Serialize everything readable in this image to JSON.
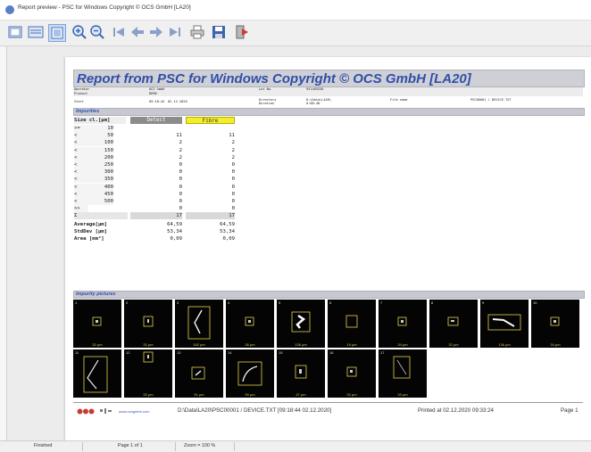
{
  "window": {
    "title": "Report preview - PSC for Windows Copyright © OCS GmbH [LA20]"
  },
  "toolbar": {
    "buttons": [
      {
        "name": "page-view-icon"
      },
      {
        "name": "page-width-icon"
      },
      {
        "name": "full-page-icon"
      },
      {
        "name": "zoom-in-icon"
      },
      {
        "name": "zoom-out-icon"
      },
      {
        "name": "first-page-icon"
      },
      {
        "name": "previous-page-icon"
      },
      {
        "name": "next-page-icon"
      },
      {
        "name": "last-page-icon"
      },
      {
        "name": "print-icon"
      },
      {
        "name": "save-icon"
      },
      {
        "name": "exit-icon"
      }
    ]
  },
  "report": {
    "title": "Report from PSC for Windows Copyright © OCS GmbH [LA20]",
    "meta": {
      "operator_label": "Operator",
      "operator_value": "OCS GmbH",
      "product_label": "Product",
      "product_value": "DEMO",
      "lot_label": "Lot No.",
      "lot_value": "931485536",
      "start_label": "Start",
      "start_date": "09:18:44",
      "start_time": "02.12.2020",
      "directory_label": "Directory",
      "directory_value": "D:\\Data\\LA20\\",
      "duration_label": "Duration",
      "duration_value": "0:00:48",
      "filename_label": "File name",
      "filename_value": "PSC00001 / DEVICE.TXT"
    },
    "impurities": {
      "section_title": "Impurities",
      "size_header": "Size cl.[µm]",
      "col_detect": "Detect",
      "col_fibre": "Fibre",
      "rows": [
        {
          "op": ">=",
          "size": "10",
          "detect": "",
          "fibre": ""
        },
        {
          "op": "<",
          "size": "50",
          "detect": "11",
          "fibre": "11"
        },
        {
          "op": "<",
          "size": "100",
          "detect": "2",
          "fibre": "2"
        },
        {
          "op": "<",
          "size": "150",
          "detect": "2",
          "fibre": "2"
        },
        {
          "op": "<",
          "size": "200",
          "detect": "2",
          "fibre": "2"
        },
        {
          "op": "<",
          "size": "250",
          "detect": "0",
          "fibre": "0"
        },
        {
          "op": "<",
          "size": "300",
          "detect": "0",
          "fibre": "0"
        },
        {
          "op": "<",
          "size": "350",
          "detect": "0",
          "fibre": "0"
        },
        {
          "op": "<",
          "size": "400",
          "detect": "0",
          "fibre": "0"
        },
        {
          "op": "<",
          "size": "450",
          "detect": "0",
          "fibre": "0"
        },
        {
          "op": "<",
          "size": "500",
          "detect": "0",
          "fibre": "0"
        },
        {
          "op": ">>",
          "size": "",
          "detect": "0",
          "fibre": "0"
        }
      ],
      "sum": {
        "label": "Σ",
        "detect": "17",
        "fibre": "17"
      },
      "stats": [
        {
          "label": "Average[µm]",
          "detect": "64,59",
          "fibre": "64,59"
        },
        {
          "label": "StdDev [µm]",
          "detect": "53,34",
          "fibre": "53,34"
        },
        {
          "label": "Area   [mm²]",
          "detect": "0,09",
          "fibre": "0,09"
        }
      ]
    },
    "pictures": {
      "section_title": "Impurity pictures",
      "items": [
        {
          "n": "1",
          "label": "32 µm"
        },
        {
          "n": "2",
          "label": "32 µm"
        },
        {
          "n": "3",
          "label": "162 µm"
        },
        {
          "n": "4",
          "label": "36 µm"
        },
        {
          "n": "5",
          "label": "136 µm"
        },
        {
          "n": "6",
          "label": "19 µm"
        },
        {
          "n": "7",
          "label": "34 µm"
        },
        {
          "n": "8",
          "label": "32 µm"
        },
        {
          "n": "9",
          "label": "136 µm"
        },
        {
          "n": "10",
          "label": "34 µm"
        },
        {
          "n": "11",
          "label": ""
        },
        {
          "n": "12",
          "label": "32 µm"
        },
        {
          "n": "13",
          "label": "51 µm"
        },
        {
          "n": "14",
          "label": "90 µm"
        },
        {
          "n": "15",
          "label": "47 µm"
        },
        {
          "n": "16",
          "label": "32 µm"
        },
        {
          "n": "17",
          "label": "33 µm"
        }
      ]
    },
    "footer": {
      "website": "www.ocsgmbh.com",
      "file_info": "D:\\Data\\LA20\\PSC00001 / DEVICE.TXT [09:18:44   02.12.2020]",
      "printed": "Printed at 02.12.2020 09:33:24",
      "page": "Page 1"
    }
  },
  "status": {
    "state": "Finished",
    "page": "Page 1 of 1",
    "zoom": "Zoom = 100 %"
  }
}
